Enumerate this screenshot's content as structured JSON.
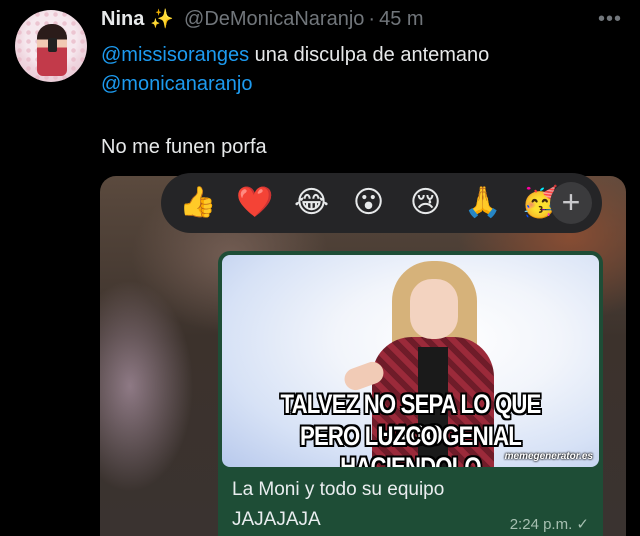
{
  "tweet": {
    "author_name": "Nina",
    "author_emoji": "✨",
    "handle": "@DeMonicaNaranjo",
    "separator": "·",
    "time_ago": "45 m",
    "more_icon": "•••",
    "text_line1_mention": "@missisoranges",
    "text_line1_rest": " una disculpa de antemano",
    "text_line2_mention": "@monicanaranjo",
    "text_line3": "No me funen porfa"
  },
  "attachment": {
    "reactions": [
      {
        "icon": "thumbs-up-icon",
        "glyph": "👍"
      },
      {
        "icon": "heart-icon",
        "glyph": "❤️"
      },
      {
        "icon": "laughing-tears-icon",
        "glyph": "😂"
      },
      {
        "icon": "surprised-icon",
        "glyph": "😮"
      },
      {
        "icon": "crying-icon",
        "glyph": "😢"
      },
      {
        "icon": "praying-hands-icon",
        "glyph": "🙏"
      },
      {
        "icon": "party-face-icon",
        "glyph": "🥳"
      }
    ],
    "add_reaction_glyph": "+",
    "message": {
      "meme_line1": "TALVEZ NO SEPA LO QUE HAGO",
      "meme_line2": "PERO LUZCO GENIAL HACIENDOLO",
      "meme_watermark": "memegenerator.es",
      "caption_line1": "La Moni y todo su equipo",
      "caption_line2": "JAJAJAJA",
      "timestamp": "2:24 p.m. ✓"
    }
  },
  "colors": {
    "background": "#000000",
    "mention": "#1d9bf0",
    "muted": "#71767b",
    "bubble": "#1e4d36",
    "reaction_bar": "#252527"
  }
}
